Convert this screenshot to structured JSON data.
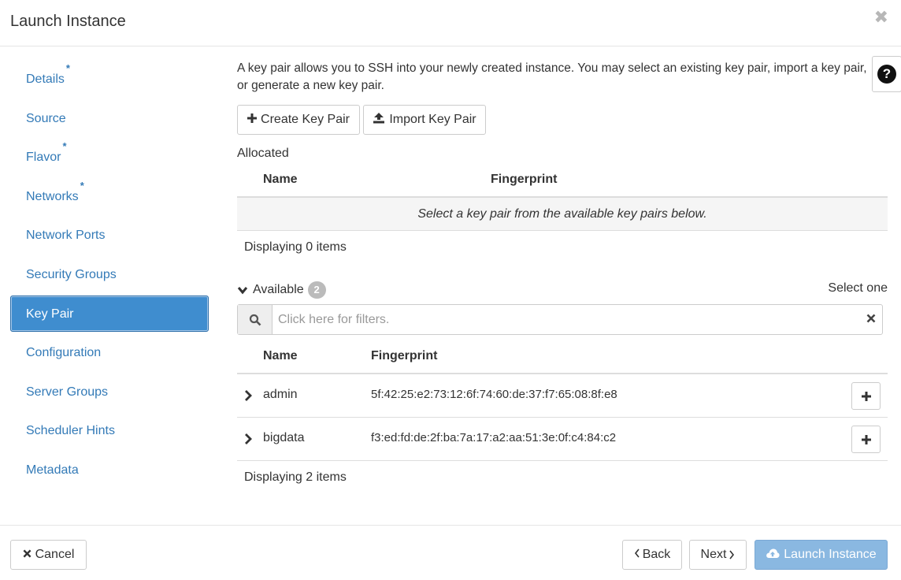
{
  "header": {
    "title": "Launch Instance",
    "close_glyph": "✖"
  },
  "sidebar": {
    "items": [
      {
        "label": "Details",
        "required": true
      },
      {
        "label": "Source",
        "required": false
      },
      {
        "label": "Flavor",
        "required": true
      },
      {
        "label": "Networks",
        "required": true
      },
      {
        "label": "Network Ports",
        "required": false
      },
      {
        "label": "Security Groups",
        "required": false
      },
      {
        "label": "Key Pair",
        "required": false,
        "active": true
      },
      {
        "label": "Configuration",
        "required": false
      },
      {
        "label": "Server Groups",
        "required": false
      },
      {
        "label": "Scheduler Hints",
        "required": false
      },
      {
        "label": "Metadata",
        "required": false
      }
    ],
    "required_marker": "*"
  },
  "main": {
    "help_text": "A key pair allows you to SSH into your newly created instance. You may select an existing key pair, import a key pair, or generate a new key pair.",
    "help_icon": "?",
    "create_label": "Create Key Pair",
    "import_label": "Import Key Pair",
    "allocated": {
      "label": "Allocated",
      "columns": [
        "Name",
        "Fingerprint"
      ],
      "empty_message": "Select a key pair from the available key pairs below.",
      "displaying": "Displaying 0 items"
    },
    "available": {
      "label": "Available",
      "count": "2",
      "select_one": "Select one",
      "filter_placeholder": "Click here for filters.",
      "columns": [
        "Name",
        "Fingerprint"
      ],
      "rows": [
        {
          "name": "admin",
          "fingerprint": "5f:42:25:e2:73:12:6f:74:60:de:37:f7:65:08:8f:e8"
        },
        {
          "name": "bigdata",
          "fingerprint": "f3:ed:fd:de:2f:ba:7a:17:a2:aa:51:3e:0f:c4:84:c2"
        }
      ],
      "displaying": "Displaying 2 items"
    }
  },
  "footer": {
    "cancel_label": "Cancel",
    "back_label": "Back",
    "next_label": "Next",
    "launch_label": "Launch Instance"
  },
  "colors": {
    "accent": "#3f8dcf",
    "link": "#337ab7",
    "launch_disabled": "#8ab8e1"
  }
}
